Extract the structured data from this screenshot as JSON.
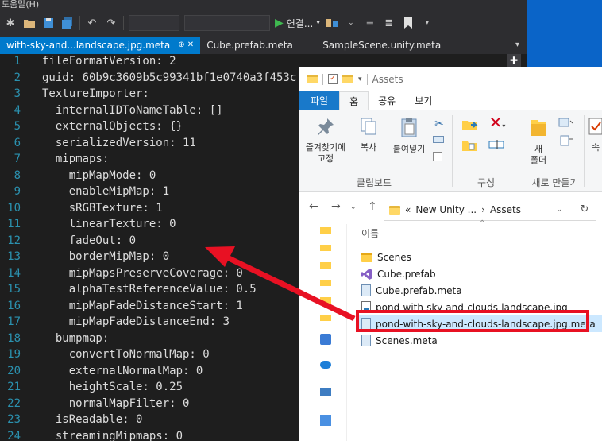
{
  "vs": {
    "menu_fragment": "도움말(H)",
    "run_label": "연결...",
    "tabs": [
      {
        "label": "with-sky-and...landscape.jpg.meta",
        "pin": "⊕ ✕"
      },
      {
        "label": "Cube.prefab.meta"
      },
      {
        "label": "SampleScene.unity.meta"
      }
    ],
    "code_lines": [
      {
        "n": "1",
        "text": "fileFormatVersion: 2"
      },
      {
        "n": "2",
        "text": "guid: 60b9c3609b5c99341bf1e0740a3f453c"
      },
      {
        "n": "3",
        "text": "TextureImporter:"
      },
      {
        "n": "4",
        "text": "  internalIDToNameTable: []"
      },
      {
        "n": "5",
        "text": "  externalObjects: {}"
      },
      {
        "n": "6",
        "text": "  serializedVersion: 11"
      },
      {
        "n": "7",
        "text": "  mipmaps:"
      },
      {
        "n": "8",
        "text": "    mipMapMode: 0"
      },
      {
        "n": "9",
        "text": "    enableMipMap: 1"
      },
      {
        "n": "10",
        "text": "    sRGBTexture: 1"
      },
      {
        "n": "11",
        "text": "    linearTexture: 0"
      },
      {
        "n": "12",
        "text": "    fadeOut: 0"
      },
      {
        "n": "13",
        "text": "    borderMipMap: 0"
      },
      {
        "n": "14",
        "text": "    mipMapsPreserveCoverage: 0"
      },
      {
        "n": "15",
        "text": "    alphaTestReferenceValue: 0.5"
      },
      {
        "n": "16",
        "text": "    mipMapFadeDistanceStart: 1"
      },
      {
        "n": "17",
        "text": "    mipMapFadeDistanceEnd: 3"
      },
      {
        "n": "18",
        "text": "  bumpmap:"
      },
      {
        "n": "19",
        "text": "    convertToNormalMap: 0"
      },
      {
        "n": "20",
        "text": "    externalNormalMap: 0"
      },
      {
        "n": "21",
        "text": "    heightScale: 0.25"
      },
      {
        "n": "22",
        "text": "    normalMapFilter: 0"
      },
      {
        "n": "23",
        "text": "  isReadable: 0"
      },
      {
        "n": "24",
        "text": "  streamingMipmaps: 0"
      }
    ]
  },
  "explorer": {
    "title_path": "Assets",
    "ribbon_tabs": [
      "파일",
      "홈",
      "공유",
      "보기"
    ],
    "ribbon": {
      "pin_label": "즐겨찾기에 고정",
      "copy_label": "복사",
      "paste_label": "붙여넣기",
      "clipboard_group": "클립보드",
      "organize_group": "구성",
      "new_folder_label": "새 폴더",
      "new_group": "새로 만들기",
      "partial_label": "속"
    },
    "address": {
      "prefix": "«",
      "crumb1": "New Unity ...",
      "sep": "›",
      "crumb2": "Assets"
    },
    "column_name": "이름",
    "files": [
      {
        "name": "Scenes",
        "icon": "folder"
      },
      {
        "name": "Cube.prefab",
        "icon": "vs"
      },
      {
        "name": "Cube.prefab.meta",
        "icon": "meta"
      },
      {
        "name": "pond-with-sky-and-clouds-landscape.jpg",
        "icon": "image"
      },
      {
        "name": "pond-with-sky-and-clouds-landscape.jpg.meta",
        "icon": "meta",
        "selected": true
      },
      {
        "name": "Scenes.meta",
        "icon": "meta"
      }
    ]
  },
  "colors": {
    "vs_accent": "#007acc",
    "editor_bg": "#1e1e1e",
    "highlight_red": "#e81123",
    "selection": "#cce8ff",
    "line_number": "#2b91af"
  }
}
